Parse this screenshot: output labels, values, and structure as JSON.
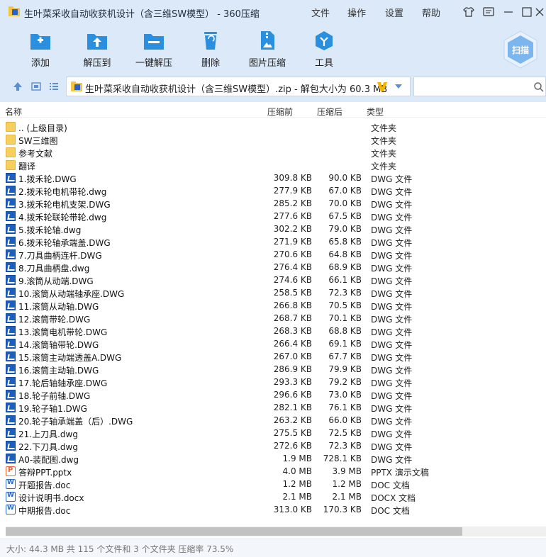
{
  "window": {
    "title": "生叶菜采收自动收获机设计（含三维SW模型） - 360压缩",
    "menu": [
      "文件",
      "操作",
      "设置",
      "帮助"
    ]
  },
  "toolbar": {
    "buttons": [
      {
        "label": "添加",
        "icon": "add-icon"
      },
      {
        "label": "解压到",
        "icon": "extract-to-icon"
      },
      {
        "label": "一键解压",
        "icon": "one-click-extract-icon"
      },
      {
        "label": "删除",
        "icon": "trash-icon"
      },
      {
        "label": "图片压缩",
        "icon": "image-compress-icon"
      },
      {
        "label": "工具",
        "icon": "tools-icon"
      }
    ],
    "scan_label": "扫描"
  },
  "address": {
    "text": "生叶菜采收自动收获机设计（含三维SW模型）.zip - 解包大小为 60.3 MB",
    "search_placeholder": ""
  },
  "columns": [
    "名称",
    "压缩前",
    "压缩后",
    "类型"
  ],
  "files": [
    {
      "name": ".. (上级目录)",
      "size": "",
      "packed": "",
      "type": "文件夹",
      "kind": "folder"
    },
    {
      "name": "SW三维图",
      "size": "",
      "packed": "",
      "type": "文件夹",
      "kind": "folder"
    },
    {
      "name": "参考文献",
      "size": "",
      "packed": "",
      "type": "文件夹",
      "kind": "folder"
    },
    {
      "name": "翻译",
      "size": "",
      "packed": "",
      "type": "文件夹",
      "kind": "folder"
    },
    {
      "name": "1.拨禾轮.DWG",
      "size": "309.8 KB",
      "packed": "90.0 KB",
      "type": "DWG 文件",
      "kind": "dwg"
    },
    {
      "name": "2.拨禾轮电机带轮.dwg",
      "size": "277.9 KB",
      "packed": "67.0 KB",
      "type": "DWG 文件",
      "kind": "dwg"
    },
    {
      "name": "3.拨禾轮电机支架.DWG",
      "size": "285.2 KB",
      "packed": "70.0 KB",
      "type": "DWG 文件",
      "kind": "dwg"
    },
    {
      "name": "4.拨禾轮联轮带轮.dwg",
      "size": "277.6 KB",
      "packed": "67.5 KB",
      "type": "DWG 文件",
      "kind": "dwg"
    },
    {
      "name": "5.拨禾轮轴.dwg",
      "size": "302.2 KB",
      "packed": "79.0 KB",
      "type": "DWG 文件",
      "kind": "dwg"
    },
    {
      "name": "6.拨禾轮轴承端盖.DWG",
      "size": "271.9 KB",
      "packed": "65.8 KB",
      "type": "DWG 文件",
      "kind": "dwg"
    },
    {
      "name": "7.刀具曲柄连杆.DWG",
      "size": "270.6 KB",
      "packed": "64.8 KB",
      "type": "DWG 文件",
      "kind": "dwg"
    },
    {
      "name": "8.刀具曲柄盘.dwg",
      "size": "276.4 KB",
      "packed": "68.9 KB",
      "type": "DWG 文件",
      "kind": "dwg"
    },
    {
      "name": "9.滚筒从动端.DWG",
      "size": "274.6 KB",
      "packed": "66.1 KB",
      "type": "DWG 文件",
      "kind": "dwg"
    },
    {
      "name": "10.滚筒从动端轴承座.DWG",
      "size": "258.5 KB",
      "packed": "72.3 KB",
      "type": "DWG 文件",
      "kind": "dwg"
    },
    {
      "name": "11.滚筒从动轴.DWG",
      "size": "266.8 KB",
      "packed": "70.5 KB",
      "type": "DWG 文件",
      "kind": "dwg"
    },
    {
      "name": "12.滚筒带轮.DWG",
      "size": "268.7 KB",
      "packed": "70.1 KB",
      "type": "DWG 文件",
      "kind": "dwg"
    },
    {
      "name": "13.滚筒电机带轮.DWG",
      "size": "268.3 KB",
      "packed": "68.8 KB",
      "type": "DWG 文件",
      "kind": "dwg"
    },
    {
      "name": "14.滚筒轴带轮.DWG",
      "size": "266.4 KB",
      "packed": "69.1 KB",
      "type": "DWG 文件",
      "kind": "dwg"
    },
    {
      "name": "15.滚筒主动端透盖A.DWG",
      "size": "267.0 KB",
      "packed": "67.7 KB",
      "type": "DWG 文件",
      "kind": "dwg"
    },
    {
      "name": "16.滚筒主动轴.DWG",
      "size": "286.9 KB",
      "packed": "79.9 KB",
      "type": "DWG 文件",
      "kind": "dwg"
    },
    {
      "name": "17.轮后轴轴承座.DWG",
      "size": "293.3 KB",
      "packed": "79.2 KB",
      "type": "DWG 文件",
      "kind": "dwg"
    },
    {
      "name": "18.轮子前轴.DWG",
      "size": "296.6 KB",
      "packed": "73.0 KB",
      "type": "DWG 文件",
      "kind": "dwg"
    },
    {
      "name": "19.轮子轴1.DWG",
      "size": "282.1 KB",
      "packed": "76.1 KB",
      "type": "DWG 文件",
      "kind": "dwg"
    },
    {
      "name": "20.轮子轴承端盖（后）.DWG",
      "size": "263.2 KB",
      "packed": "66.0 KB",
      "type": "DWG 文件",
      "kind": "dwg"
    },
    {
      "name": "21.上刀具.dwg",
      "size": "275.5 KB",
      "packed": "72.5 KB",
      "type": "DWG 文件",
      "kind": "dwg"
    },
    {
      "name": "22.下刀具.dwg",
      "size": "272.6 KB",
      "packed": "72.3 KB",
      "type": "DWG 文件",
      "kind": "dwg"
    },
    {
      "name": "A0-装配图.dwg",
      "size": "1.9 MB",
      "packed": "728.1 KB",
      "type": "DWG 文件",
      "kind": "dwg"
    },
    {
      "name": "答辩PPT.pptx",
      "size": "4.0 MB",
      "packed": "3.9 MB",
      "type": "PPTX 演示文稿",
      "kind": "ppt"
    },
    {
      "name": "开题报告.doc",
      "size": "1.2 MB",
      "packed": "1.2 MB",
      "type": "DOC 文档",
      "kind": "doc"
    },
    {
      "name": "设计说明书.docx",
      "size": "2.1 MB",
      "packed": "2.1 MB",
      "type": "DOCX 文档",
      "kind": "doc"
    },
    {
      "name": "中期报告.doc",
      "size": "313.0 KB",
      "packed": "170.3 KB",
      "type": "DOC 文档",
      "kind": "doc"
    }
  ],
  "status": "大小: 44.3 MB 共 115 个文件和 3 个文件夹 压缩率 73.5%",
  "colors": {
    "chrome": "#dce9f8",
    "accent": "#1e6fd9",
    "folder": "#f7cf5f",
    "dwg": "#1b5fc2"
  }
}
